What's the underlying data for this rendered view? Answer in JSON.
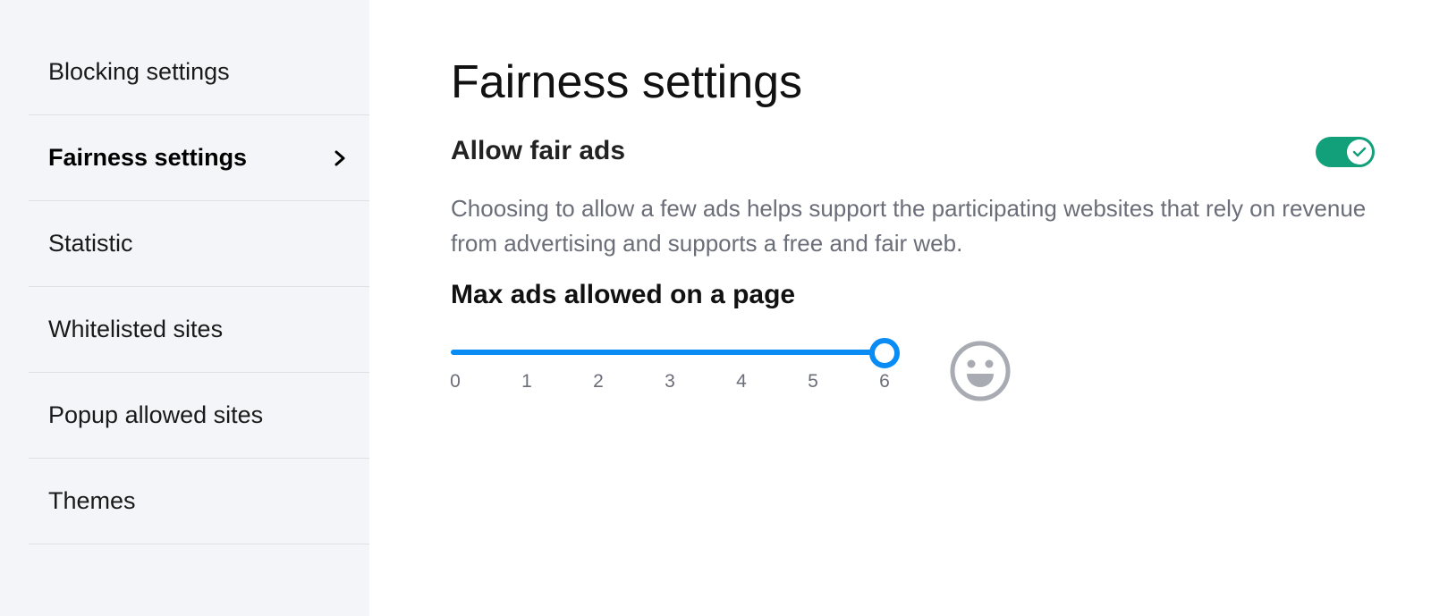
{
  "sidebar": {
    "items": [
      {
        "label": "Blocking settings",
        "active": false
      },
      {
        "label": "Fairness settings",
        "active": true
      },
      {
        "label": "Statistic",
        "active": false
      },
      {
        "label": "Whitelisted sites",
        "active": false
      },
      {
        "label": "Popup allowed sites",
        "active": false
      },
      {
        "label": "Themes",
        "active": false
      }
    ],
    "active_icon": "chevron-right-icon"
  },
  "main": {
    "title": "Fairness settings",
    "allow_fair_ads": {
      "label": "Allow fair ads",
      "enabled": true,
      "toggle_color": "#12a07a",
      "icon": "check-icon"
    },
    "description": "Choosing to allow a few ads helps support the participating websites that rely on revenue from advertising and supports a free and fair web.",
    "max_ads": {
      "label": "Max ads allowed on a page",
      "min": 0,
      "max": 6,
      "value": 6,
      "ticks": [
        "0",
        "1",
        "2",
        "3",
        "4",
        "5",
        "6"
      ],
      "accent_color": "#0a8cf5",
      "indicator_icon": "grinning-face-icon"
    }
  }
}
